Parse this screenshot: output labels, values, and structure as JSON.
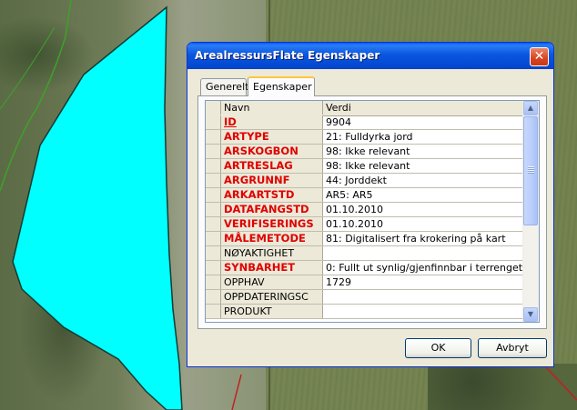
{
  "window": {
    "title": "ArealressursFlate Egenskaper",
    "close_glyph": "✕"
  },
  "tabs": [
    {
      "label": "Generelt",
      "active": false
    },
    {
      "label": "Egenskaper",
      "active": true
    }
  ],
  "grid": {
    "columns": [
      "Navn",
      "Verdi"
    ],
    "rows": [
      {
        "name": "ID",
        "value": "9904"
      },
      {
        "name": "ARTYPE",
        "value": "21: Fulldyrka jord"
      },
      {
        "name": "ARSKOGBON",
        "value": "98: Ikke relevant"
      },
      {
        "name": "ARTRESLAG",
        "value": "98: Ikke relevant"
      },
      {
        "name": "ARGRUNNF",
        "value": "44: Jorddekt"
      },
      {
        "name": "ARKARTSTD",
        "value": "AR5: AR5"
      },
      {
        "name": "DATAFANGSTD",
        "value": "01.10.2010"
      },
      {
        "name": "VERIFISERINGS",
        "value": "01.10.2010"
      },
      {
        "name": "MÅLEMETODE",
        "value": "81: Digitalisert fra krokering på kart"
      },
      {
        "name": "NØYAKTIGHET",
        "value": ""
      },
      {
        "name": "SYNBARHET",
        "value": "0: Fullt ut synlig/gjenfinnbar i terrenget"
      },
      {
        "name": "OPPHAV",
        "value": "1729"
      },
      {
        "name": "OPPDATERINGSC",
        "value": ""
      },
      {
        "name": "PRODUKT",
        "value": ""
      }
    ]
  },
  "scrollbar": {
    "up_glyph": "▲",
    "down_glyph": "▼"
  },
  "buttons": {
    "ok": "OK",
    "cancel": "Avbryt"
  },
  "colors": {
    "required_field_text": "#e00000",
    "selected_polygon_fill": "#00ffff",
    "titlebar": "#0b57df"
  }
}
